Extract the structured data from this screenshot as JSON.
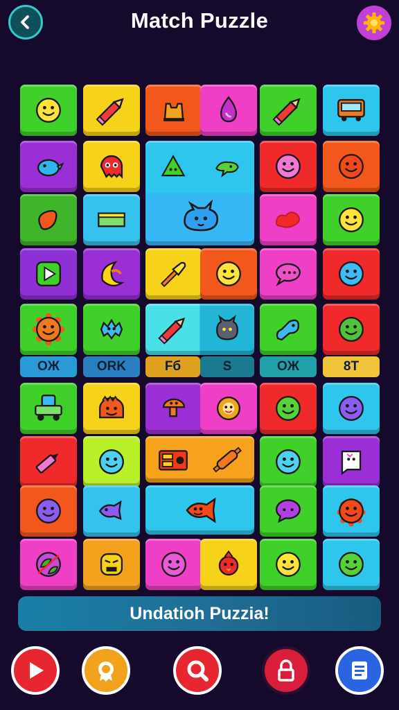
{
  "header": {
    "title": "Match Puzzle",
    "back_icon": "chevron-left-icon",
    "settings_icon": "gear-icon"
  },
  "board": {
    "rows": 10,
    "columns": 6,
    "tiles": [
      {
        "row": 1,
        "col": 1,
        "colors": [
          "#3fd12a"
        ],
        "icon": "smiley-face"
      },
      {
        "row": 1,
        "col": 2,
        "colors": [
          "#f6d21a"
        ],
        "icon": "pencil"
      },
      {
        "row": 1,
        "col": 3,
        "colors": [
          "#f2581c"
        ],
        "icon": "shoe"
      },
      {
        "row": 1,
        "col": 4,
        "colors": [
          "#ef3fc7"
        ],
        "icon": "paint-drop"
      },
      {
        "row": 1,
        "col": 5,
        "colors": [
          "#3fd12a"
        ],
        "icon": "pencil"
      },
      {
        "row": 1,
        "col": 6,
        "colors": [
          "#2fc6ee"
        ],
        "icon": "bus"
      },
      {
        "row": 2,
        "col": 1,
        "colors": [
          "#9b2fd6"
        ],
        "icon": "bird"
      },
      {
        "row": 2,
        "col": 2,
        "colors": [
          "#f6d21a"
        ],
        "icon": "red-monster"
      },
      {
        "row": 2,
        "col": 5,
        "colors": [
          "#f02a2a"
        ],
        "icon": "pink-blob"
      },
      {
        "row": 2,
        "col": 6,
        "colors": [
          "#f2581c"
        ],
        "icon": "red-face"
      },
      {
        "row": 3,
        "col": 1,
        "colors": [
          "#3fb52a"
        ],
        "icon": "bean"
      },
      {
        "row": 3,
        "col": 2,
        "colors": [
          "#36c2ee"
        ],
        "icon": "box"
      },
      {
        "row": 3,
        "col": 5,
        "colors": [
          "#ef3fc7"
        ],
        "icon": "red-blob"
      },
      {
        "row": 3,
        "col": 6,
        "colors": [
          "#3fd12a"
        ],
        "icon": "smiley-face"
      },
      {
        "row": 4,
        "col": 1,
        "colors": [
          "#8f2fd6"
        ],
        "icon": "play-button"
      },
      {
        "row": 4,
        "col": 2,
        "colors": [
          "#9b2fd6"
        ],
        "icon": "banana"
      },
      {
        "row": 4,
        "col": 3,
        "colors": [
          "#f6d21a"
        ],
        "icon": "paintbrush"
      },
      {
        "row": 4,
        "col": 4,
        "colors": [
          "#f2581c"
        ],
        "icon": "smiley-face"
      },
      {
        "row": 4,
        "col": 5,
        "colors": [
          "#ef3fc7"
        ],
        "icon": "speech-bubble"
      },
      {
        "row": 4,
        "col": 6,
        "colors": [
          "#f02a2a"
        ],
        "icon": "blue-grin"
      },
      {
        "row": 5,
        "col": 1,
        "colors": [
          "#3fd12a"
        ],
        "icon": "sun-face"
      },
      {
        "row": 5,
        "col": 2,
        "colors": [
          "#3fd12a"
        ],
        "icon": "blue-fluff"
      },
      {
        "row": 5,
        "col": 5,
        "colors": [
          "#3fd12a"
        ],
        "icon": "blue-fish"
      },
      {
        "row": 5,
        "col": 6,
        "colors": [
          "#f02a2a"
        ],
        "icon": "green-creature"
      },
      {
        "row": 7,
        "col": 1,
        "colors": [
          "#3fd12a"
        ],
        "icon": "robot-car"
      },
      {
        "row": 7,
        "col": 2,
        "colors": [
          "#f6d21a"
        ],
        "icon": "orange-monster"
      },
      {
        "row": 7,
        "col": 3,
        "colors": [
          "#9b2fd6"
        ],
        "icon": "orange-mushroom"
      },
      {
        "row": 7,
        "col": 4,
        "colors": [
          "#ef3fc7"
        ],
        "icon": "donut-face"
      },
      {
        "row": 7,
        "col": 5,
        "colors": [
          "#f02a2a"
        ],
        "icon": "green-face"
      },
      {
        "row": 7,
        "col": 6,
        "colors": [
          "#2fc6ee"
        ],
        "icon": "purple-face"
      },
      {
        "row": 8,
        "col": 1,
        "colors": [
          "#f02a2a"
        ],
        "icon": "marker"
      },
      {
        "row": 8,
        "col": 2,
        "colors": [
          "#b8f02a"
        ],
        "icon": "blue-face"
      },
      {
        "row": 8,
        "col": 5,
        "colors": [
          "#3fd12a"
        ],
        "icon": "blue-face"
      },
      {
        "row": 8,
        "col": 6,
        "colors": [
          "#9b2fd6"
        ],
        "icon": "ghost-note"
      },
      {
        "row": 9,
        "col": 1,
        "colors": [
          "#f2581c"
        ],
        "icon": "purple-face"
      },
      {
        "row": 9,
        "col": 2,
        "colors": [
          "#36c2ee"
        ],
        "icon": "purple-fish"
      },
      {
        "row": 9,
        "col": 5,
        "colors": [
          "#3fd12a"
        ],
        "icon": "purple-bubble"
      },
      {
        "row": 9,
        "col": 6,
        "colors": [
          "#2fc6ee"
        ],
        "icon": "spiky-red"
      },
      {
        "row": 10,
        "col": 1,
        "colors": [
          "#ef3fc7"
        ],
        "icon": "leaf-ball"
      },
      {
        "row": 10,
        "col": 2,
        "colors": [
          "#f2a21c"
        ],
        "icon": "grumpy-face"
      },
      {
        "row": 10,
        "col": 3,
        "colors": [
          "#ef3fc7"
        ],
        "icon": "pink-face"
      },
      {
        "row": 10,
        "col": 4,
        "colors": [
          "#f6d21a"
        ],
        "icon": "red-bird"
      },
      {
        "row": 10,
        "col": 5,
        "colors": [
          "#3fd12a"
        ],
        "icon": "smiley-face"
      },
      {
        "row": 10,
        "col": 6,
        "colors": [
          "#2fc6ee"
        ],
        "icon": "green-face"
      }
    ],
    "big_tiles": [
      {
        "rows": "2-3",
        "cols": "3-4",
        "colors": [
          "#2fc6ee",
          "#36b8f5"
        ],
        "icons": [
          "green-triangle",
          "green-bird",
          "blue-cat"
        ]
      },
      {
        "rows": "5",
        "cols": "3-4",
        "colors": [
          "#49e0e8",
          "#22b6d6"
        ],
        "icons": [
          "pencil",
          "grey-cat"
        ]
      },
      {
        "rows": "8",
        "cols": "3-4",
        "colors": [
          "#f6a21c"
        ],
        "icons": [
          "radio",
          "rolling-pin"
        ]
      },
      {
        "rows": "9",
        "cols": "3-4",
        "colors": [
          "#2fc6ee"
        ],
        "icons": [
          "red-fish"
        ]
      }
    ],
    "labels": [
      {
        "text": "OЖ",
        "color": "#2a9ad6"
      },
      {
        "text": "ORK",
        "color": "#2a7fc0"
      },
      {
        "text": "Fб",
        "color": "#e0a020"
      },
      {
        "text": "S",
        "color": "#1a7a90"
      },
      {
        "text": "OЖ",
        "color": "#22a0a8"
      },
      {
        "text": "8T",
        "color": "#f2c43a"
      }
    ]
  },
  "banner": {
    "text": "Undatioh Puzzia!"
  },
  "bottom_bar": [
    {
      "name": "play",
      "icon": "play-icon",
      "fill": "#e8262f",
      "ring": "#ffffff"
    },
    {
      "name": "badge",
      "icon": "badge-icon",
      "fill": "#f2a21c",
      "ring": "#ffffff"
    },
    {
      "name": "search",
      "icon": "search-icon",
      "fill": "#e8262f",
      "ring": "#ffffff"
    },
    {
      "name": "lock",
      "icon": "lock-icon",
      "fill": "#d81e3a",
      "ring": "#2a0f2f"
    },
    {
      "name": "list",
      "icon": "list-icon",
      "fill": "#2a64e0",
      "ring": "#ffffff"
    }
  ]
}
